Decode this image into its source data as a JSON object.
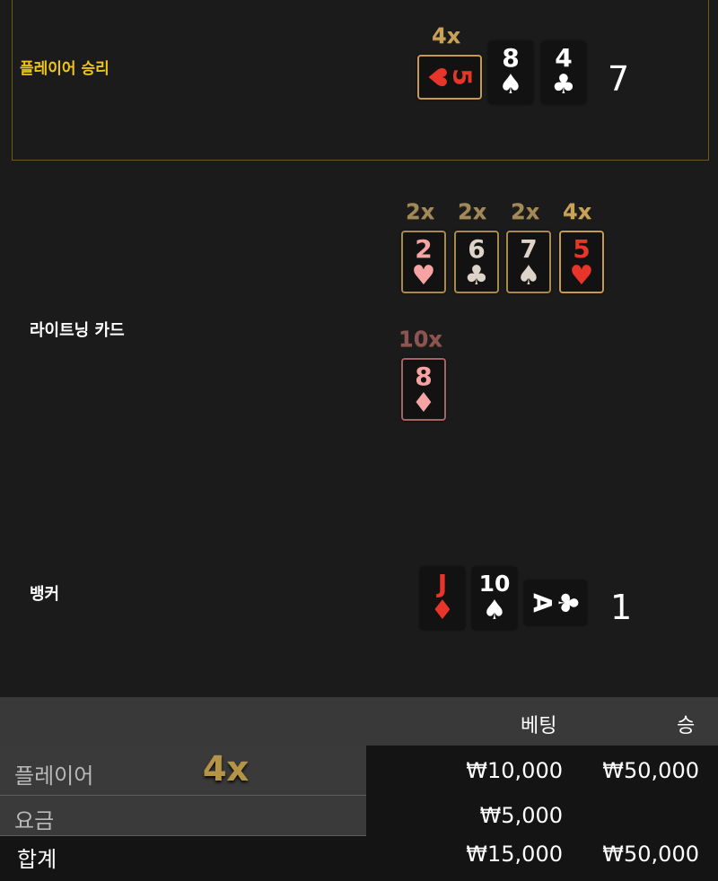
{
  "sections": {
    "player_label": "플레이어 승리",
    "lightning_label": "라이트닝 카드",
    "banker_label": "뱅커"
  },
  "player": {
    "multiplier": "4x",
    "cards": [
      {
        "rank": "5",
        "suit": "♥"
      },
      {
        "rank": "8",
        "suit": "♠"
      },
      {
        "rank": "4",
        "suit": "♣"
      }
    ],
    "score": "7"
  },
  "lightning": {
    "cards": [
      {
        "rank": "2",
        "suit": "♥",
        "multiplier": "2x"
      },
      {
        "rank": "6",
        "suit": "♣",
        "multiplier": "2x"
      },
      {
        "rank": "7",
        "suit": "♠",
        "multiplier": "2x"
      },
      {
        "rank": "5",
        "suit": "♥",
        "multiplier": "4x"
      },
      {
        "rank": "8",
        "suit": "♦",
        "multiplier": "10x"
      }
    ]
  },
  "banker": {
    "cards": [
      {
        "rank": "J",
        "suit": "♦"
      },
      {
        "rank": "10",
        "suit": "♠"
      },
      {
        "rank": "A",
        "suit": "♣"
      }
    ],
    "score": "1"
  },
  "summary": {
    "headers": {
      "bet": "베팅",
      "win": "승"
    },
    "rows": [
      {
        "label": "플레이어",
        "multiplier": "4x",
        "bet": "₩10,000",
        "win": "₩50,000"
      },
      {
        "label": "요금",
        "bet": "₩5,000",
        "win": ""
      },
      {
        "label": "합계",
        "bet": "₩15,000",
        "win": "₩50,000"
      }
    ]
  },
  "colors": {
    "background": "#1b1b1b",
    "gold": "#c8a258",
    "player_label": "#f0c419",
    "red_suit": "#e8352a"
  }
}
